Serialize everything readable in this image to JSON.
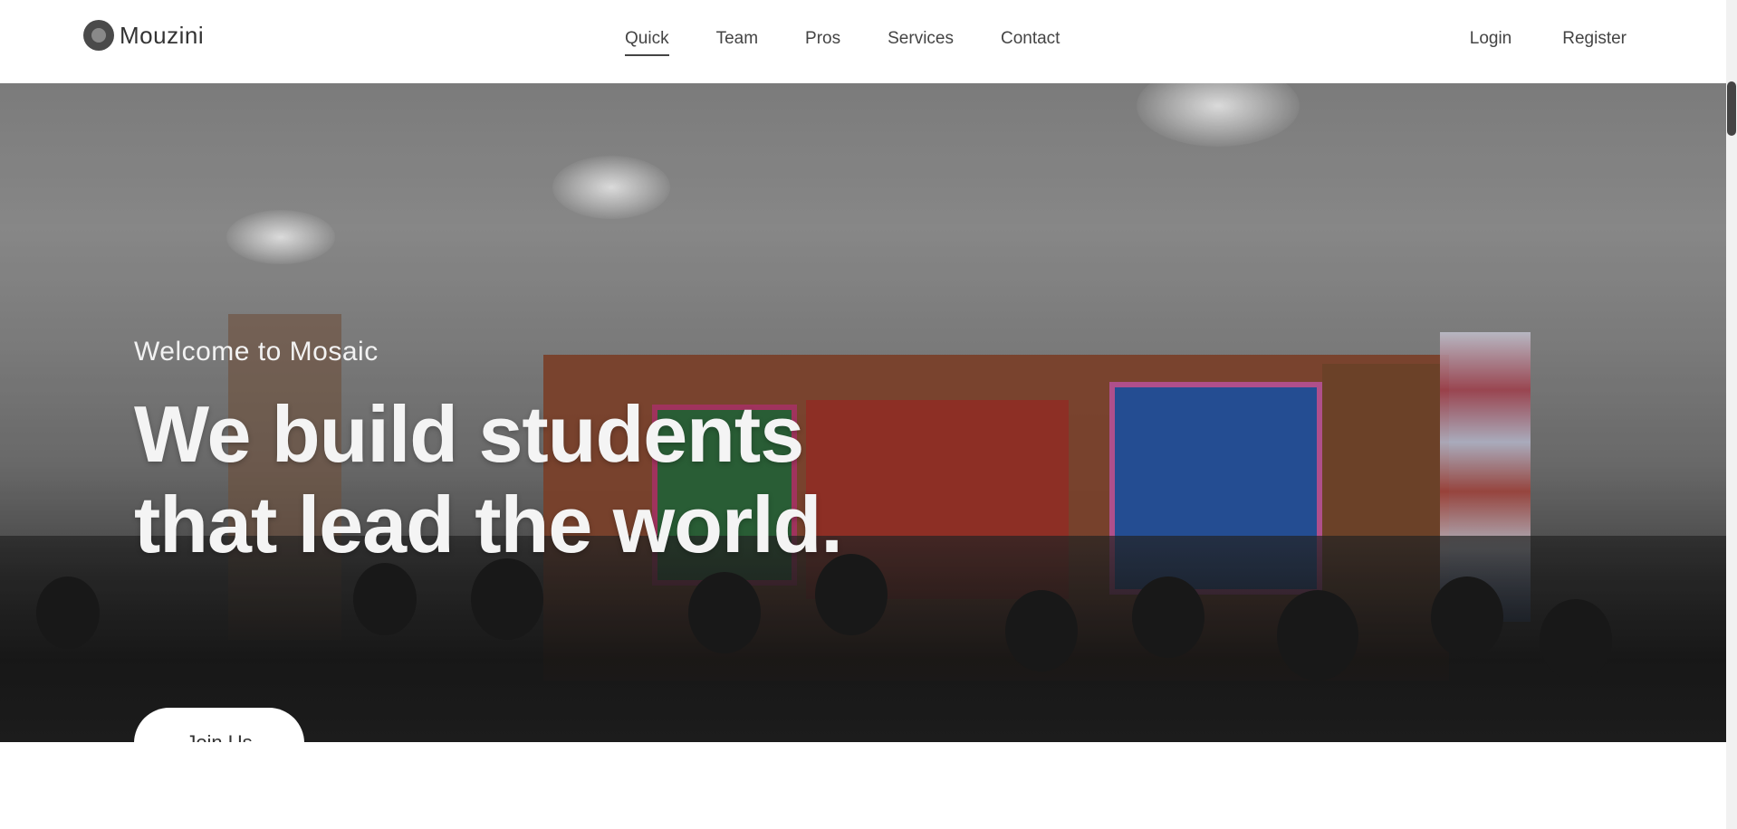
{
  "header": {
    "logo_text": "Mouzini",
    "nav": [
      {
        "label": "Quick",
        "active": true
      },
      {
        "label": "Team",
        "active": false
      },
      {
        "label": "Pros",
        "active": false
      },
      {
        "label": "Services",
        "active": false
      },
      {
        "label": "Contact",
        "active": false
      }
    ],
    "auth": {
      "login_label": "Login",
      "register_label": "Register"
    }
  },
  "hero": {
    "welcome_text": "Welcome to Mosaic",
    "headline_line1": "We build students",
    "headline_line2": "that lead the world.",
    "cta_label": "Join Us"
  },
  "icons": {
    "logo": "logo-icon"
  },
  "colors": {
    "header_bg": "#ffffff",
    "nav_text": "#444444",
    "hero_text": "#f4f4f4",
    "button_bg": "#ffffff"
  }
}
